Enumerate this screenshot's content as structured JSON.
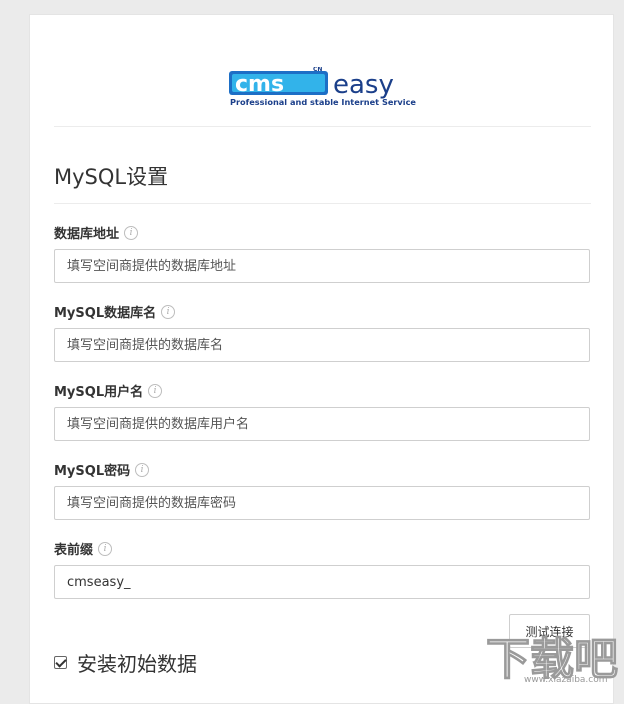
{
  "logo": {
    "brand": "cmseasy",
    "badge": "CN",
    "tagline": "Professional and stable Internet Service",
    "colors": {
      "blue": "#1d6fc6",
      "cyan": "#32b3ea",
      "navy": "#1b3f8a"
    }
  },
  "section_title": "MySQL设置",
  "fields": [
    {
      "label": "数据库地址",
      "value": "",
      "placeholder": "填写空间商提供的数据库地址"
    },
    {
      "label": "MySQL数据库名",
      "value": "",
      "placeholder": "填写空间商提供的数据库名"
    },
    {
      "label": "MySQL用户名",
      "value": "",
      "placeholder": "填写空间商提供的数据库用户名"
    },
    {
      "label": "MySQL密码",
      "value": "",
      "placeholder": "填写空间商提供的数据库密码"
    },
    {
      "label": "表前缀",
      "value": "cmseasy_",
      "placeholder": ""
    }
  ],
  "test_button_label": "测试连接",
  "install_checkbox": {
    "label": "安装初始数据",
    "checked": true
  },
  "watermark": {
    "text": "下载吧",
    "url": "www.xiazaiba.com"
  }
}
